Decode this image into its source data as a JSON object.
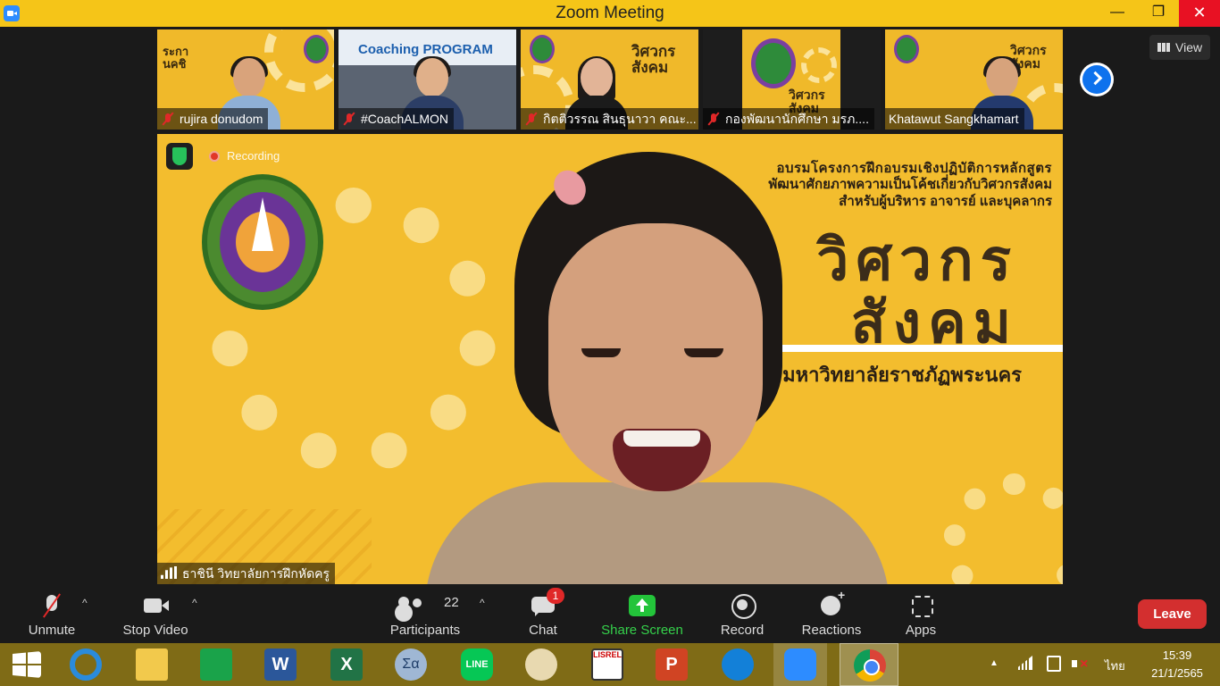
{
  "window": {
    "title": "Zoom Meeting",
    "controls": {
      "minimize": "—",
      "maximize": "❐",
      "close": "✕"
    }
  },
  "view_button": {
    "label": "View"
  },
  "thumbnails": [
    {
      "name": "rujira donudom",
      "muted": true,
      "slide_text": "ระกา\nนคชิ"
    },
    {
      "name": "#CoachALMON",
      "muted": true,
      "slide_text": "Coaching PROGRAM"
    },
    {
      "name": "กิตติวรรณ สินธุนาวา คณะ...",
      "muted": true,
      "slide_text": "วิศวกร\nสังคม"
    },
    {
      "name": "กองพัฒนานักศึกษา มรภ....",
      "muted": true,
      "slide_text": "วิศวกร\nสังคม"
    },
    {
      "name": "Khatawut Sangkhamart",
      "muted": false,
      "slide_text": "วิศวกร\nสังคม"
    }
  ],
  "main_video": {
    "recording_label": "Recording",
    "speaker_name": "ธาชินี  วิทยาลัยการฝึกหัดครู",
    "banner": {
      "line1": "อบรมโครงการฝึกอบรมเชิงปฏิบัติการหลักสูตร",
      "line2": "พัฒนาศักยภาพความเป็นโค้ชเกี่ยวกับวิศวกรสังคม",
      "line3": "สำหรับผู้บริหาร อาจารย์ และบุคลากร",
      "big1": "วิศวกร",
      "big2": "สังคม",
      "university": "มหาวิทยาลัยราชภัฏพระนคร"
    }
  },
  "toolbar": {
    "unmute": "Unmute",
    "stop_video": "Stop Video",
    "participants": "Participants",
    "participants_count": "22",
    "chat": "Chat",
    "chat_badge": "1",
    "share_screen": "Share Screen",
    "record": "Record",
    "reactions": "Reactions",
    "apps": "Apps",
    "leave": "Leave",
    "caret": "^"
  },
  "taskbar": {
    "apps": [
      "start-menu",
      "internet-explorer",
      "file-explorer",
      "microsoft-store",
      "word",
      "excel",
      "calculator",
      "line",
      "paint",
      "lisrel",
      "powerpoint",
      "edge",
      "zoom",
      "chrome"
    ],
    "word_letter": "W",
    "excel_letter": "X",
    "ppt_letter": "P",
    "line_label": "LINE",
    "lisrel_label": "LISREL",
    "calc_label": "Σα",
    "tray_up": "▲",
    "language": "ไทย",
    "time": "15:39",
    "date": "21/1/2565"
  },
  "colors": {
    "titlebar": "#f5c518",
    "leave": "#d32f2f",
    "share": "#23c43a",
    "accent": "#0e72ed"
  }
}
